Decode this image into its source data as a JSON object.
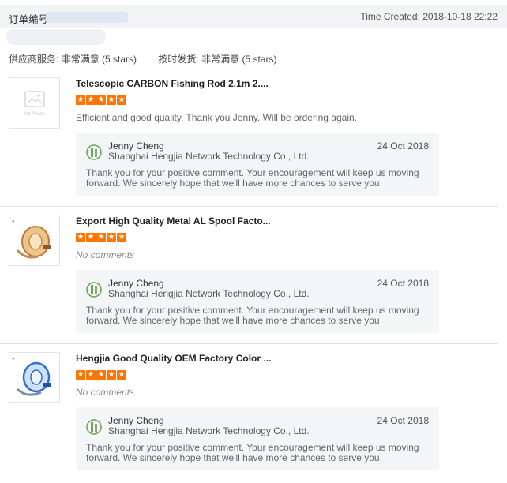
{
  "header": {
    "order_label": "订单编号",
    "time_created": "Time Created: 2018-10-18 22:22"
  },
  "ratings": {
    "supplier_service_label": "供应商服务:",
    "supplier_service_value": "非常满意",
    "supplier_service_stars": "(5 stars)",
    "shipping_label": "按时发货:",
    "shipping_value": "非常满意",
    "shipping_stars": "(5 stars)"
  },
  "items": [
    {
      "title": "Telescopic CARBON Fishing Rod 2.1m 2....",
      "stars": 5,
      "comment": "Efficient and good quality. Thank you Jenny. Will be ordering again.",
      "thumb_placeholder": "No Photo",
      "reply": {
        "name": "Jenny Cheng",
        "company": "Shanghai Hengjia Network Technology Co., Ltd.",
        "date": "24 Oct 2018",
        "text": "Thank you for your positive comment. Your encouragement will keep us moving forward. We sincerely hope that we'll have more chances to serve you"
      }
    },
    {
      "title": "Export High Quality Metal AL Spool Facto...",
      "stars": 5,
      "comment": "No comments",
      "reply": {
        "name": "Jenny Cheng",
        "company": "Shanghai Hengjia Network Technology Co., Ltd.",
        "date": "24 Oct 2018",
        "text": "Thank you for your positive comment. Your encouragement will keep us moving forward. We sincerely hope that we'll have more chances to serve you"
      }
    },
    {
      "title": "Hengjia Good Quality OEM Factory Color ...",
      "stars": 5,
      "comment": "No comments",
      "reply": {
        "name": "Jenny Cheng",
        "company": "Shanghai Hengjia Network Technology Co., Ltd.",
        "date": "24 Oct 2018",
        "text": "Thank you for your positive comment. Your encouragement will keep us moving forward. We sincerely hope that we'll have more chances to serve you"
      }
    }
  ],
  "colors": {
    "star": "#ff7300",
    "header_bg": "#f2f3f5",
    "reply_bg": "#f4f5f7"
  }
}
